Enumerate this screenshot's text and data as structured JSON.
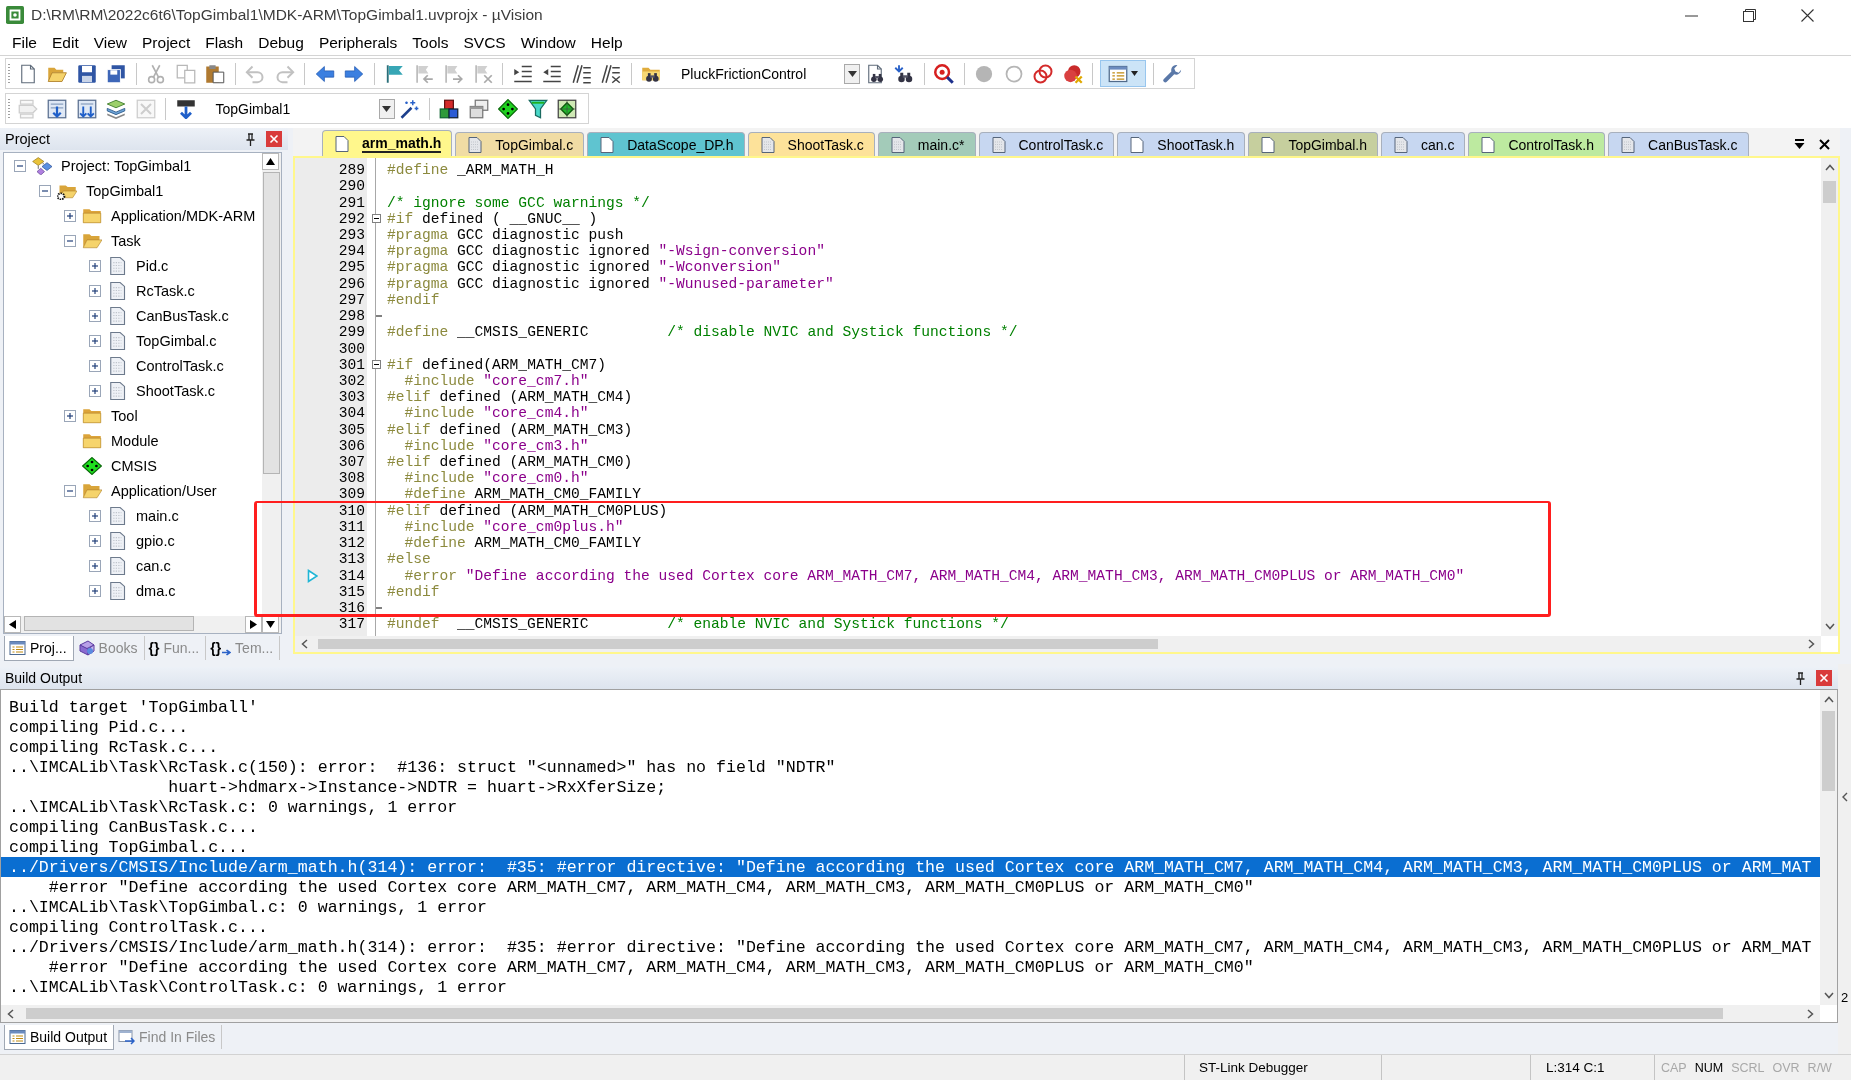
{
  "window": {
    "title": "D:\\RM\\RM\\2022c6t6\\TopGimbal1\\MDK-ARM\\TopGimbal1.uvprojx - µVision"
  },
  "menu": [
    "File",
    "Edit",
    "View",
    "Project",
    "Flash",
    "Debug",
    "Peripherals",
    "Tools",
    "SVCS",
    "Window",
    "Help"
  ],
  "toolbars": [
    {
      "items": [
        {
          "kind": "new",
          "disabled": false,
          "pressed": false
        },
        {
          "kind": "open",
          "disabled": false,
          "pressed": false
        },
        {
          "kind": "save",
          "disabled": false,
          "pressed": false
        },
        {
          "kind": "saveall",
          "disabled": false,
          "pressed": false
        },
        {
          "kind": "separator"
        },
        {
          "kind": "cut",
          "disabled": true,
          "pressed": false
        },
        {
          "kind": "copy",
          "disabled": true,
          "pressed": false
        },
        {
          "kind": "paste",
          "disabled": false,
          "pressed": false
        },
        {
          "kind": "separator"
        },
        {
          "kind": "undo",
          "disabled": true,
          "pressed": false
        },
        {
          "kind": "redo",
          "disabled": true,
          "pressed": false
        },
        {
          "kind": "separator"
        },
        {
          "kind": "back",
          "disabled": false,
          "pressed": false
        },
        {
          "kind": "forward",
          "disabled": false,
          "pressed": false
        },
        {
          "kind": "separator"
        },
        {
          "kind": "bookmark",
          "disabled": false,
          "pressed": false
        },
        {
          "kind": "prevmark",
          "disabled": true,
          "pressed": false
        },
        {
          "kind": "nextmark",
          "disabled": true,
          "pressed": false
        },
        {
          "kind": "clearmarks",
          "disabled": true,
          "pressed": false
        },
        {
          "kind": "separator"
        },
        {
          "kind": "indent",
          "disabled": false,
          "pressed": false
        },
        {
          "kind": "outdent",
          "disabled": false,
          "pressed": false
        },
        {
          "kind": "comment",
          "disabled": false,
          "pressed": false
        },
        {
          "kind": "uncomment",
          "disabled": false,
          "pressed": false
        },
        {
          "kind": "separator"
        },
        {
          "kind": "findfiles",
          "disabled": false,
          "pressed": false
        },
        {
          "kind": "combo",
          "value": "PluckFrictionControl"
        },
        {
          "kind": "find",
          "disabled": false,
          "pressed": false
        },
        {
          "kind": "incfind",
          "disabled": false,
          "pressed": false
        },
        {
          "kind": "separator"
        },
        {
          "kind": "debug",
          "disabled": false,
          "pressed": false
        },
        {
          "kind": "separator"
        },
        {
          "kind": "breakpoint",
          "disabled": true,
          "pressed": false
        },
        {
          "kind": "bpenable",
          "disabled": true,
          "pressed": false
        },
        {
          "kind": "bpdisableall",
          "disabled": false,
          "pressed": false
        },
        {
          "kind": "bpkill",
          "disabled": false,
          "pressed": false
        },
        {
          "kind": "separator"
        },
        {
          "kind": "layout",
          "disabled": false,
          "pressed": true
        },
        {
          "kind": "separator"
        },
        {
          "kind": "wrench",
          "disabled": false,
          "pressed": false
        }
      ]
    },
    {
      "items": [
        {
          "kind": "translate",
          "disabled": true,
          "pressed": false
        },
        {
          "kind": "build",
          "disabled": false,
          "pressed": false
        },
        {
          "kind": "rebuild",
          "disabled": false,
          "pressed": false
        },
        {
          "kind": "batch",
          "disabled": false,
          "pressed": false
        },
        {
          "kind": "stop",
          "disabled": true,
          "pressed": false
        },
        {
          "kind": "separator"
        },
        {
          "kind": "load",
          "disabled": false,
          "pressed": false
        },
        {
          "kind": "combo",
          "value": "TopGimbal1"
        },
        {
          "kind": "wand",
          "disabled": false,
          "pressed": false
        },
        {
          "kind": "separator"
        },
        {
          "kind": "components",
          "disabled": false,
          "pressed": false
        },
        {
          "kind": "packs",
          "disabled": false,
          "pressed": false
        },
        {
          "kind": "diamond",
          "disabled": false,
          "pressed": false
        },
        {
          "kind": "funnel",
          "disabled": false,
          "pressed": false
        },
        {
          "kind": "installer",
          "disabled": false,
          "pressed": false
        }
      ]
    }
  ],
  "project_panel": {
    "title": "Project",
    "tree": [
      {
        "label": "Project: TopGimbal1",
        "kind": "project",
        "expanded": true,
        "children": [
          {
            "label": "TopGimbal1",
            "kind": "target",
            "expanded": true,
            "children": [
              {
                "label": "Application/MDK-ARM",
                "kind": "folder",
                "expanded": false
              },
              {
                "label": "Task",
                "kind": "folder",
                "expanded": true,
                "children": [
                  {
                    "label": "Pid.c",
                    "kind": "file",
                    "expanded": false
                  },
                  {
                    "label": "RcTask.c",
                    "kind": "file",
                    "expanded": false
                  },
                  {
                    "label": "CanBusTask.c",
                    "kind": "file",
                    "expanded": false
                  },
                  {
                    "label": "TopGimbal.c",
                    "kind": "file",
                    "expanded": false
                  },
                  {
                    "label": "ControlTask.c",
                    "kind": "file",
                    "expanded": false
                  },
                  {
                    "label": "ShootTask.c",
                    "kind": "file",
                    "expanded": false
                  }
                ]
              },
              {
                "label": "Tool",
                "kind": "folder",
                "expanded": false
              },
              {
                "label": "Module",
                "kind": "folder"
              },
              {
                "label": "CMSIS",
                "kind": "component"
              },
              {
                "label": "Application/User",
                "kind": "folder",
                "expanded": true,
                "children": [
                  {
                    "label": "main.c",
                    "kind": "file",
                    "expanded": false
                  },
                  {
                    "label": "gpio.c",
                    "kind": "file",
                    "expanded": false
                  },
                  {
                    "label": "can.c",
                    "kind": "file",
                    "expanded": false
                  },
                  {
                    "label": "dma.c",
                    "kind": "file",
                    "expanded": false
                  }
                ]
              }
            ]
          }
        ]
      }
    ],
    "tabs": [
      {
        "kind": "project",
        "label": "Proj...",
        "selected": true
      },
      {
        "kind": "books",
        "label": "Books",
        "selected": false
      },
      {
        "kind": "functions",
        "glyph": "{}",
        "label": "Fun...",
        "selected": false
      },
      {
        "kind": "templates",
        "glyph": "{}",
        "label": "Tem...",
        "selected": false
      }
    ]
  },
  "editor": {
    "tabs": [
      {
        "label": "arm_math.h",
        "kind": "header",
        "color": "#fff78c",
        "selected": true
      },
      {
        "label": "TopGimbal.c",
        "kind": "source",
        "color": "#f0dca4",
        "selected": false
      },
      {
        "label": "DataScope_DP.h",
        "kind": "header",
        "color": "#5fc4d0",
        "selected": false
      },
      {
        "label": "ShootTask.c",
        "kind": "source",
        "color": "#fde29a",
        "selected": false
      },
      {
        "label": "main.c*",
        "kind": "source",
        "color": "#a3cbb9",
        "selected": false
      },
      {
        "label": "ControlTask.c",
        "kind": "source",
        "color": "#c7d7f1",
        "selected": false
      },
      {
        "label": "ShootTask.h",
        "kind": "header",
        "color": "#c7d7f1",
        "selected": false
      },
      {
        "label": "TopGimbal.h",
        "kind": "header",
        "color": "#c6cf9e",
        "selected": false
      },
      {
        "label": "can.c",
        "kind": "source",
        "color": "#c7d7f1",
        "selected": false
      },
      {
        "label": "ControlTask.h",
        "kind": "header",
        "color": "#bdeaa0",
        "selected": false
      },
      {
        "label": "CanBusTask.c",
        "kind": "source",
        "color": "#c7d7f1",
        "selected": false
      }
    ],
    "lines": [
      {
        "number": "289",
        "kind": "code",
        "current": false,
        "segments": [
          {
            "kind": "directive",
            "text": "#define"
          },
          {
            "kind": "plain",
            "text": " _ARM_MATH_H"
          }
        ]
      },
      {
        "number": "290",
        "kind": "code",
        "current": false
      },
      {
        "number": "291",
        "kind": "code",
        "current": false,
        "segments": [
          {
            "kind": "comment",
            "text": "/* ignore some GCC warnings */"
          }
        ]
      },
      {
        "number": "292",
        "kind": "foldstart",
        "current": false,
        "segments": [
          {
            "kind": "directive",
            "text": "#if"
          },
          {
            "kind": "plain",
            "text": " defined ( __GNUC__ )"
          }
        ]
      },
      {
        "number": "293",
        "kind": "code",
        "current": false,
        "segments": [
          {
            "kind": "directive",
            "text": "#pragma"
          },
          {
            "kind": "plain",
            "text": " GCC diagnostic push"
          }
        ]
      },
      {
        "number": "294",
        "kind": "code",
        "current": false,
        "segments": [
          {
            "kind": "directive",
            "text": "#pragma"
          },
          {
            "kind": "plain",
            "text": " GCC diagnostic ignored "
          },
          {
            "kind": "string",
            "text": "\"-Wsign-conversion\""
          }
        ]
      },
      {
        "number": "295",
        "kind": "code",
        "current": false,
        "segments": [
          {
            "kind": "directive",
            "text": "#pragma"
          },
          {
            "kind": "plain",
            "text": " GCC diagnostic ignored "
          },
          {
            "kind": "string",
            "text": "\"-Wconversion\""
          }
        ]
      },
      {
        "number": "296",
        "kind": "code",
        "current": false,
        "segments": [
          {
            "kind": "directive",
            "text": "#pragma"
          },
          {
            "kind": "plain",
            "text": " GCC diagnostic ignored "
          },
          {
            "kind": "string",
            "text": "\"-Wunused-parameter\""
          }
        ]
      },
      {
        "number": "297",
        "kind": "code",
        "current": false,
        "segments": [
          {
            "kind": "directive",
            "text": "#endif"
          }
        ]
      },
      {
        "number": "298",
        "kind": "foldend",
        "current": false
      },
      {
        "number": "299",
        "kind": "code",
        "current": false,
        "segments": [
          {
            "kind": "directive",
            "text": "#define"
          },
          {
            "kind": "plain",
            "text": " __CMSIS_GENERIC         "
          },
          {
            "kind": "comment",
            "text": "/* disable NVIC and Systick functions */"
          }
        ]
      },
      {
        "number": "300",
        "kind": "code",
        "current": false
      },
      {
        "number": "301",
        "kind": "foldstart",
        "current": false,
        "segments": [
          {
            "kind": "directive",
            "text": "#if"
          },
          {
            "kind": "plain",
            "text": " defined(ARM_MATH_CM7)"
          }
        ]
      },
      {
        "number": "302",
        "kind": "code",
        "current": false,
        "segments": [
          {
            "kind": "directive",
            "text": "  #include "
          },
          {
            "kind": "string",
            "text": "\"core_cm7.h\""
          }
        ]
      },
      {
        "number": "303",
        "kind": "code",
        "current": false,
        "segments": [
          {
            "kind": "directive",
            "text": "#elif"
          },
          {
            "kind": "plain",
            "text": " defined (ARM_MATH_CM4)"
          }
        ]
      },
      {
        "number": "304",
        "kind": "code",
        "current": false,
        "segments": [
          {
            "kind": "directive",
            "text": "  #include "
          },
          {
            "kind": "string",
            "text": "\"core_cm4.h\""
          }
        ]
      },
      {
        "number": "305",
        "kind": "code",
        "current": false,
        "segments": [
          {
            "kind": "directive",
            "text": "#elif"
          },
          {
            "kind": "plain",
            "text": " defined (ARM_MATH_CM3)"
          }
        ]
      },
      {
        "number": "306",
        "kind": "code",
        "current": false,
        "segments": [
          {
            "kind": "directive",
            "text": "  #include "
          },
          {
            "kind": "string",
            "text": "\"core_cm3.h\""
          }
        ]
      },
      {
        "number": "307",
        "kind": "code",
        "current": false,
        "segments": [
          {
            "kind": "directive",
            "text": "#elif"
          },
          {
            "kind": "plain",
            "text": " defined (ARM_MATH_CM0)"
          }
        ]
      },
      {
        "number": "308",
        "kind": "code",
        "current": false,
        "segments": [
          {
            "kind": "directive",
            "text": "  #include "
          },
          {
            "kind": "string",
            "text": "\"core_cm0.h\""
          }
        ]
      },
      {
        "number": "309",
        "kind": "code",
        "current": false,
        "segments": [
          {
            "kind": "directive",
            "text": "  #define"
          },
          {
            "kind": "plain",
            "text": " ARM_MATH_CM0_FAMILY"
          }
        ]
      },
      {
        "number": "310",
        "kind": "code",
        "current": false,
        "segments": [
          {
            "kind": "directive",
            "text": "#elif"
          },
          {
            "kind": "plain",
            "text": " defined (ARM_MATH_CM0PLUS)"
          }
        ]
      },
      {
        "number": "311",
        "kind": "code",
        "current": false,
        "segments": [
          {
            "kind": "directive",
            "text": "  #include "
          },
          {
            "kind": "string",
            "text": "\"core_cm0plus.h\""
          }
        ]
      },
      {
        "number": "312",
        "kind": "code",
        "current": false,
        "segments": [
          {
            "kind": "directive",
            "text": "  #define"
          },
          {
            "kind": "plain",
            "text": " ARM_MATH_CM0_FAMILY"
          }
        ]
      },
      {
        "number": "313",
        "kind": "code",
        "current": false,
        "segments": [
          {
            "kind": "directive",
            "text": "#else"
          }
        ]
      },
      {
        "number": "314",
        "kind": "code",
        "current": true,
        "segments": [
          {
            "kind": "directive",
            "text": "  #error "
          },
          {
            "kind": "string",
            "text": "\"Define according the used Cortex core ARM_MATH_CM7, ARM_MATH_CM4, ARM_MATH_CM3, ARM_MATH_CM0PLUS or ARM_MATH_CM0\""
          }
        ]
      },
      {
        "number": "315",
        "kind": "code",
        "current": false,
        "segments": [
          {
            "kind": "directive",
            "text": "#endif"
          }
        ]
      },
      {
        "number": "316",
        "kind": "foldend",
        "current": false
      },
      {
        "number": "317",
        "kind": "code",
        "current": false,
        "segments": [
          {
            "kind": "directive",
            "text": "#undef"
          },
          {
            "kind": "plain",
            "text": "  __CMSIS_GENERIC         "
          },
          {
            "kind": "comment",
            "text": "/* enable NVIC and Systick functions */"
          }
        ]
      }
    ]
  },
  "annotation": {
    "kind": "rectangle"
  },
  "build_output": {
    "title": "Build Output",
    "lines": [
      {
        "text": "Build target 'TopGimball'",
        "selected": false
      },
      {
        "text": "compiling Pid.c...",
        "selected": false
      },
      {
        "text": "compiling RcTask.c...",
        "selected": false
      },
      {
        "text": "..\\IMCALib\\Task\\RcTask.c(150): error:  #136: struct \"<unnamed>\" has no field \"NDTR\"",
        "selected": false
      },
      {
        "text": "                huart->hdmarx->Instance->NDTR = huart->RxXferSize;",
        "selected": false
      },
      {
        "text": "..\\IMCALib\\Task\\RcTask.c: 0 warnings, 1 error",
        "selected": false
      },
      {
        "text": "compiling CanBusTask.c...",
        "selected": false
      },
      {
        "text": "compiling TopGimbal.c...",
        "selected": false
      },
      {
        "text": "../Drivers/CMSIS/Include/arm_math.h(314): error:  #35: #error directive: \"Define according the used Cortex core ARM_MATH_CM7, ARM_MATH_CM4, ARM_MATH_CM3, ARM_MATH_CM0PLUS or ARM_MAT",
        "selected": true
      },
      {
        "text": "    #error \"Define according the used Cortex core ARM_MATH_CM7, ARM_MATH_CM4, ARM_MATH_CM3, ARM_MATH_CM0PLUS or ARM_MATH_CM0\"",
        "selected": false
      },
      {
        "text": "..\\IMCALib\\Task\\TopGimbal.c: 0 warnings, 1 error",
        "selected": false
      },
      {
        "text": "compiling ControlTask.c...",
        "selected": false
      },
      {
        "text": "../Drivers/CMSIS/Include/arm_math.h(314): error:  #35: #error directive: \"Define according the used Cortex core ARM_MATH_CM7, ARM_MATH_CM4, ARM_MATH_CM3, ARM_MATH_CM0PLUS or ARM_MAT",
        "selected": false
      },
      {
        "text": "    #error \"Define according the used Cortex core ARM_MATH_CM7, ARM_MATH_CM4, ARM_MATH_CM3, ARM_MATH_CM0PLUS or ARM_MATH_CM0\"",
        "selected": false
      },
      {
        "text": "..\\IMCALib\\Task\\ControlTask.c: 0 warnings, 1 error",
        "selected": false
      }
    ],
    "tabs": [
      {
        "kind": "output",
        "label": "Build Output",
        "selected": true
      },
      {
        "kind": "find",
        "label": "Find In Files",
        "selected": false
      }
    ],
    "side_label": "2"
  },
  "status_bar": {
    "debugger": "ST-Link Debugger",
    "position": "L:314 C:1",
    "indicators": [
      {
        "label": "CAP",
        "on": false
      },
      {
        "label": "NUM",
        "on": true
      },
      {
        "label": "SCRL",
        "on": false
      },
      {
        "label": "OVR",
        "on": false
      },
      {
        "label": "R/W",
        "on": false
      }
    ]
  }
}
